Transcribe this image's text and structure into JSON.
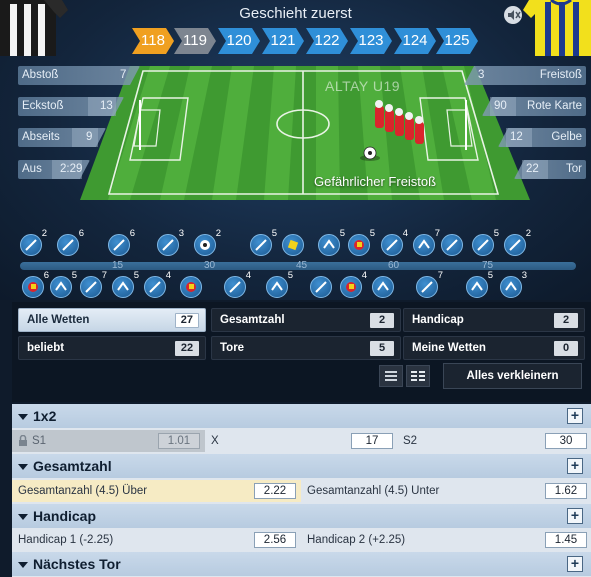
{
  "header": {
    "headline": "Geschieht zuerst",
    "team_name": "ALTAY U19",
    "event_text": "Gefährlicher Freistoß"
  },
  "minutes": [
    "118",
    "119",
    "120",
    "121",
    "122",
    "123",
    "124",
    "125"
  ],
  "stats_left": [
    {
      "label": "Abstoß",
      "value": "7"
    },
    {
      "label": "Eckstoß",
      "value": "13"
    },
    {
      "label": "Abseits",
      "value": "9"
    },
    {
      "label": "Aus",
      "value": "2:29"
    }
  ],
  "stats_right": [
    {
      "label": "Freistoß",
      "value": "3"
    },
    {
      "label": "Rote Karte",
      "value": "90"
    },
    {
      "label": "Gelbe",
      "value": "12"
    },
    {
      "label": "Tor",
      "value": "22"
    }
  ],
  "timeline": {
    "ticks": [
      "15",
      "30",
      "45",
      "60",
      "75"
    ],
    "top_counts": [
      "2",
      "6",
      "6",
      "3",
      "2",
      "5",
      "5",
      "5",
      "4",
      "7",
      "2",
      "5",
      "2"
    ],
    "bottom_counts": [
      "6",
      "5",
      "7",
      "5",
      "4",
      "4",
      "5",
      "4",
      "7",
      "5",
      "3"
    ]
  },
  "filters": {
    "all_bets": {
      "label": "Alle Wetten",
      "count": "27"
    },
    "popular": {
      "label": "beliebt",
      "count": "22"
    },
    "total": {
      "label": "Gesamtzahl",
      "count": "2"
    },
    "goals": {
      "label": "Tore",
      "count": "5"
    },
    "handicap": {
      "label": "Handicap",
      "count": "2"
    },
    "my_bets": {
      "label": "Meine Wetten",
      "count": "0"
    },
    "collapse_label": "Alles verkleinern"
  },
  "markets": {
    "m1x2": {
      "title": "1x2",
      "s1_label": "S1",
      "s1_odd": "1.01",
      "x_label": "X",
      "x_odd": "17",
      "s2_label": "S2",
      "s2_odd": "30"
    },
    "total": {
      "title": "Gesamtzahl",
      "over_label": "Gesamtanzahl (4.5) Über",
      "over_odd": "2.22",
      "under_label": "Gesamtanzahl (4.5) Unter",
      "under_odd": "1.62"
    },
    "handicap": {
      "title": "Handicap",
      "h1_label": "Handicap 1 (-2.25)",
      "h1_odd": "2.56",
      "h2_label": "Handicap 2 (+2.25)",
      "h2_odd": "1.45"
    },
    "next_goal": {
      "title": "Nächstes Tor"
    }
  },
  "colors": {
    "minute_past": "#f0a020",
    "minute_gray": "#7d8590",
    "minute_future": "#2f8fd8",
    "pitch_light": "#4fae3c",
    "pitch_dark": "#3f9a31",
    "panel_header": "#bccfe3",
    "highlight_row": "#f6ebc4"
  }
}
